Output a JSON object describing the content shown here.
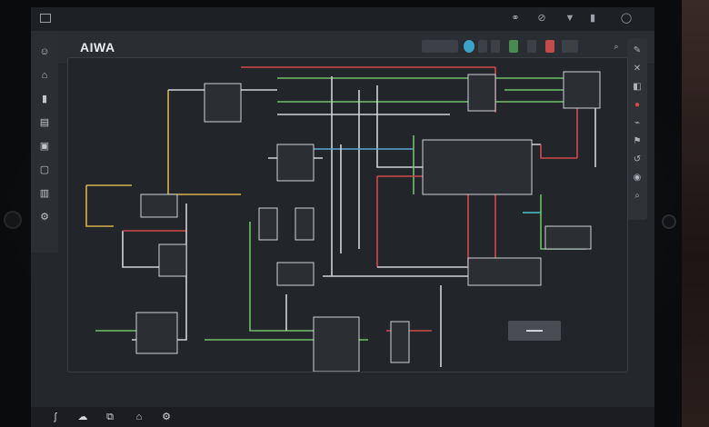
{
  "app": {
    "title": "AIWA"
  },
  "statusbar": {
    "icons": [
      "link-icon",
      "no-signal-icon",
      "wifi-icon",
      "battery-icon",
      "power-icon"
    ]
  },
  "toolbar": {
    "icons": [
      "search-icon",
      "info-icon",
      "grid-icon",
      "layers-icon",
      "component-icon",
      "save-icon",
      "list-icon",
      "zoom-icon"
    ]
  },
  "sidebar_left": {
    "icons": [
      "chat-icon",
      "home-icon",
      "menu-icon",
      "doc-icon",
      "clipboard-icon",
      "page-icon",
      "panel-icon",
      "settings-icon"
    ]
  },
  "sidebar_right": {
    "icons": [
      "pencil-icon",
      "close-icon",
      "record-icon",
      "brush-icon",
      "flag-icon",
      "undo-icon",
      "eye-icon",
      "search-icon"
    ]
  },
  "bottombar": {
    "icons": [
      "tool-icon",
      "cloud-icon",
      "copy-icon",
      "tag-icon",
      "settings-icon"
    ]
  },
  "colors": {
    "wire_white": "#cfd3d8",
    "wire_red": "#d04a4a",
    "wire_green": "#6fbf6a",
    "wire_blue": "#5aa6d6",
    "wire_yellow": "#d4b24a",
    "wire_cyan": "#4ac1c8",
    "accent": "#e34a4a"
  }
}
